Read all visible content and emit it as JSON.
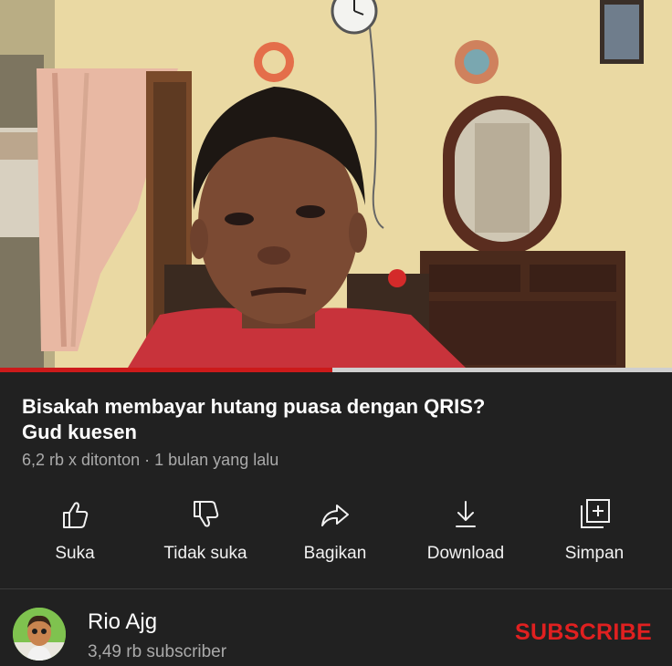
{
  "video": {
    "title_line1": "Bisakah membayar hutang puasa dengan QRIS?",
    "title_line2": "Gud kuesen",
    "views": "6,2 rb x ditonton",
    "separator": "·",
    "age": "1 bulan yang lalu",
    "progress_fraction": 0.495
  },
  "actions": [
    {
      "label": "Suka",
      "icon": "thumbs-up-icon"
    },
    {
      "label": "Tidak suka",
      "icon": "thumbs-down-icon"
    },
    {
      "label": "Bagikan",
      "icon": "share-icon"
    },
    {
      "label": "Download",
      "icon": "download-icon"
    },
    {
      "label": "Simpan",
      "icon": "save-playlist-icon"
    }
  ],
  "channel": {
    "name": "Rio Ajg",
    "subscribers": "3,49 rb subscriber",
    "subscribe_label": "SUBSCRIBE"
  },
  "colors": {
    "background": "#212121",
    "progress": "#cc1a1a",
    "subscribe": "#e02020"
  }
}
